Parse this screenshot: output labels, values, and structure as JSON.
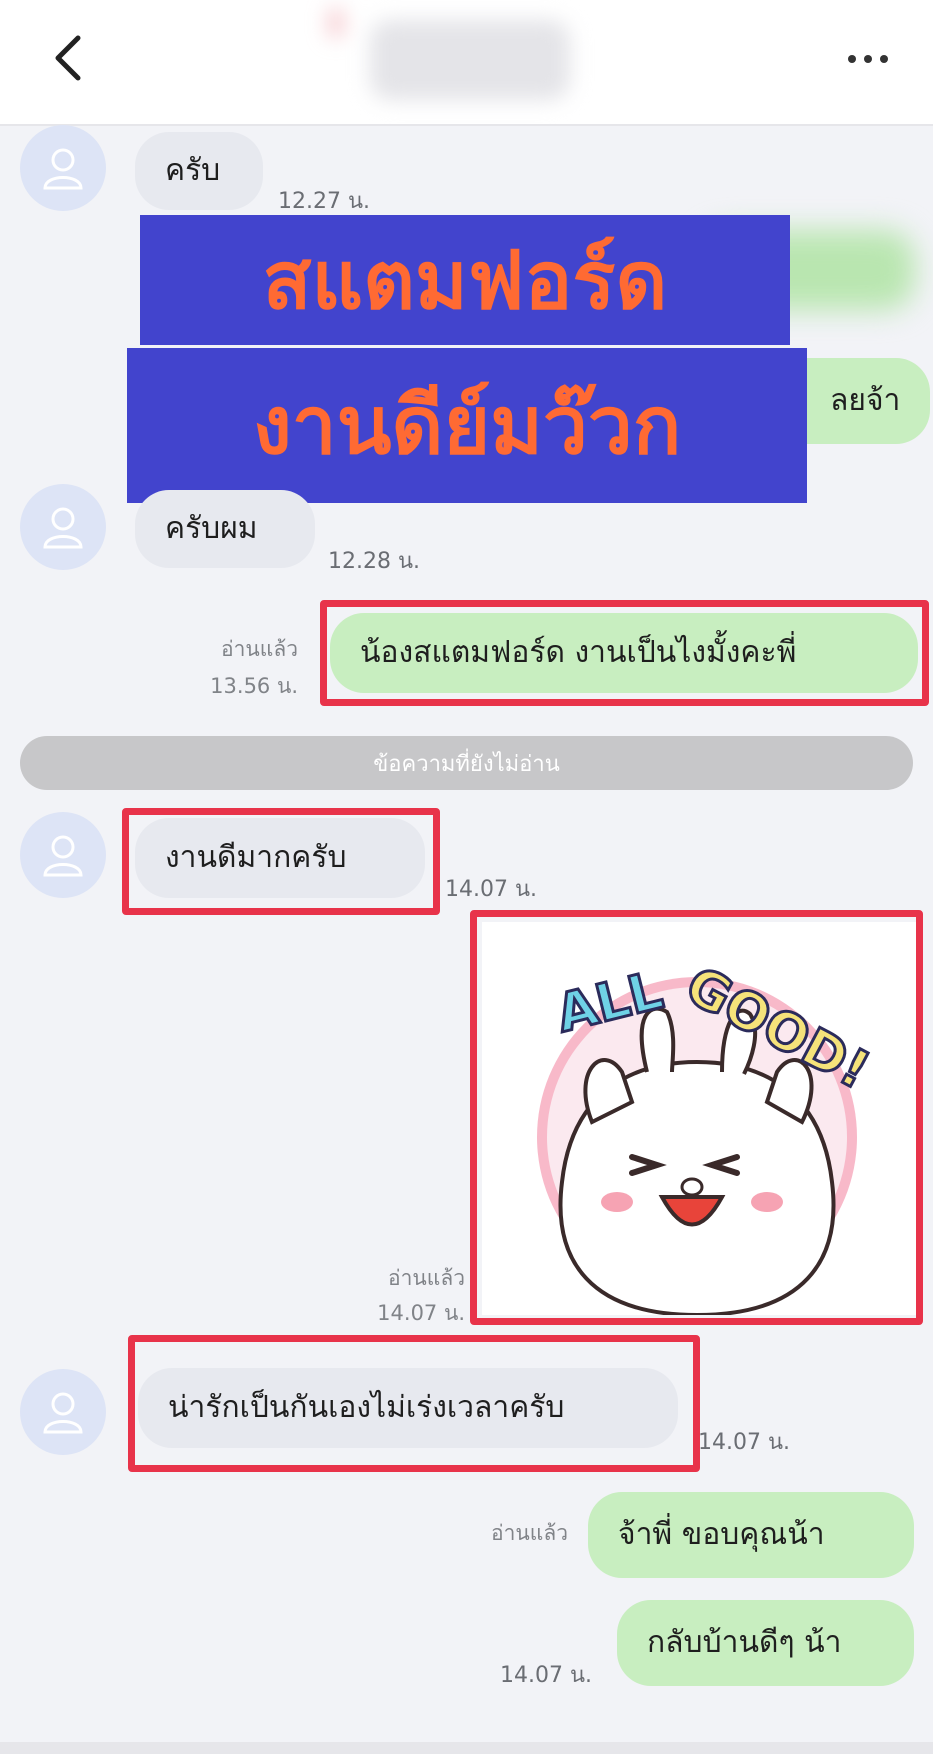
{
  "overlay_banner": {
    "line1": "สแตมฟอร์ด",
    "line2": "งานดีย์มว๊วก"
  },
  "messages": {
    "m1": {
      "text": "ครับ",
      "time": "12.27 น."
    },
    "m2_partial": {
      "text": "ลยจ้า"
    },
    "m3": {
      "text": "ครับผม",
      "time": "12.28 น."
    },
    "m4": {
      "text": "น้องสแตมฟอร์ด งานเป็นไงมั้งคะพี่",
      "read": "อ่านแล้ว",
      "time": "13.56 น."
    },
    "m5": {
      "text": "งานดีมากครับ",
      "time": "14.07 น."
    },
    "m6": {
      "sticker_text": "ALL GOOD!",
      "read": "อ่านแล้ว",
      "time": "14.07 น."
    },
    "m7": {
      "text": "น่ารักเป็นกันเองไม่เร่งเวลาครับ",
      "time": "14.07 น."
    },
    "m8": {
      "text": "จ้าพี่ ขอบคุณน้า",
      "read": "อ่านแล้ว"
    },
    "m9": {
      "text": "กลับบ้านดีๆ น้า",
      "time": "14.07 น."
    }
  },
  "unread_divider": "ข้อความที่ยังไม่อ่าน",
  "icons": {
    "back": "chevron-left-icon",
    "more": "more-horizontal-icon",
    "avatar": "user-icon"
  },
  "colors": {
    "incoming": "#e7e9ef",
    "outgoing": "#c8eec0",
    "highlight": "#e8334a",
    "banner_bg": "#4244cd",
    "banner_text": "#ff6a33"
  }
}
